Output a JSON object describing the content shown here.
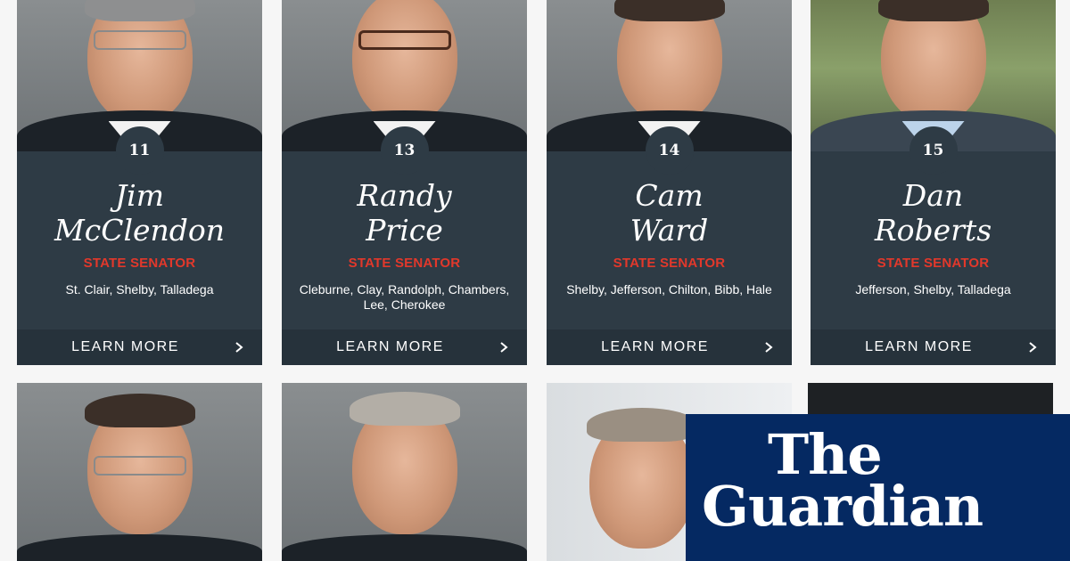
{
  "cards": [
    {
      "number": "11",
      "name_first": "Jim",
      "name_last": "McClendon",
      "role": "STATE SENATOR",
      "counties": "St. Clair, Shelby, Talladega",
      "cta": "LEARN MORE"
    },
    {
      "number": "13",
      "name_first": "Randy",
      "name_last": "Price",
      "role": "STATE SENATOR",
      "counties": "Cleburne, Clay, Randolph, Chambers, Lee, Cherokee",
      "cta": "LEARN MORE"
    },
    {
      "number": "14",
      "name_first": "Cam",
      "name_last": "Ward",
      "role": "STATE SENATOR",
      "counties": "Shelby, Jefferson, Chilton, Bibb, Hale",
      "cta": "LEARN MORE"
    },
    {
      "number": "15",
      "name_first": "Dan",
      "name_last": "Roberts",
      "role": "STATE SENATOR",
      "counties": "Jefferson, Shelby, Talladega",
      "cta": "LEARN MORE"
    }
  ],
  "logo": {
    "line1": "The",
    "line2": "Guardian"
  },
  "colors": {
    "panel": "#2e3b45",
    "role_red": "#e2382b",
    "guardian_blue": "#052962"
  },
  "icons": {
    "cta": "chevron-right-icon"
  }
}
